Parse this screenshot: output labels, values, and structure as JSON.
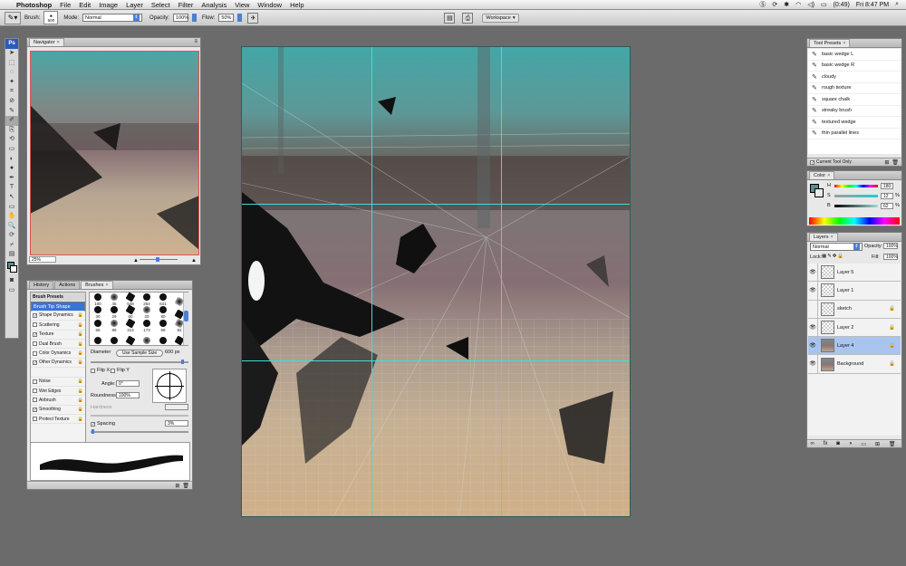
{
  "menubar": {
    "app": "Photoshop",
    "items": [
      "File",
      "Edit",
      "Image",
      "Layer",
      "Select",
      "Filter",
      "Analysis",
      "View",
      "Window",
      "Help"
    ],
    "battery": "(0:49)",
    "clock": "Fri 8:47 PM"
  },
  "options": {
    "brush_label": "Brush:",
    "brush_size": "600",
    "mode_label": "Mode:",
    "mode_value": "Normal",
    "opacity_label": "Opacity:",
    "opacity_value": "100%",
    "flow_label": "Flow:",
    "flow_value": "50%",
    "workspace_label": "Workspace"
  },
  "tools": {
    "logo": "Ps",
    "glyphs": [
      "➤",
      "⬚",
      "◌",
      "✦",
      "⌗",
      "⊘",
      "✎",
      "✐",
      "⎘",
      "⟲",
      "▭",
      "◐",
      "●",
      "✒",
      "T",
      "↖",
      "▭",
      "✋",
      "🔍"
    ]
  },
  "navigator": {
    "tab": "Navigator",
    "zoom": "25%"
  },
  "brushes_panel": {
    "tabs": [
      "History",
      "Actions",
      "Brushes"
    ],
    "rows": [
      {
        "label": "Brush Presets",
        "type": "header"
      },
      {
        "label": "Brush Tip Shape",
        "type": "selected"
      },
      {
        "label": "Shape Dynamics",
        "checked": true
      },
      {
        "label": "Scattering",
        "checked": false
      },
      {
        "label": "Texture",
        "checked": true
      },
      {
        "label": "Dual Brush",
        "checked": false
      },
      {
        "label": "Color Dynamics",
        "checked": false
      },
      {
        "label": "Other Dynamics",
        "checked": true
      },
      {
        "label": "",
        "checked": null
      },
      {
        "label": "Noise",
        "checked": false
      },
      {
        "label": "Wet Edges",
        "checked": false
      },
      {
        "label": "Airbrush",
        "checked": false
      },
      {
        "label": "Smoothing",
        "checked": true
      },
      {
        "label": "Protect Texture",
        "checked": false
      }
    ],
    "tips": [
      "100",
      "45",
      "548",
      "264",
      "641",
      "",
      "30",
      "29",
      "60",
      "20",
      "80",
      "",
      "65",
      "89",
      "314",
      "173",
      "59",
      "82",
      "",
      "",
      "",
      "",
      "",
      ""
    ],
    "diameter_label": "Diameter",
    "use_sample": "Use Sample Size",
    "diameter_value": "600 px",
    "flipx": "Flip X",
    "flipy": "Flip Y",
    "angle_label": "Angle:",
    "angle_value": "0°",
    "roundness_label": "Roundness:",
    "roundness_value": "100%",
    "hardness_label": "Hardness",
    "spacing_label": "Spacing",
    "spacing_value": "3%"
  },
  "tool_presets": {
    "tab": "Tool Presets",
    "items": [
      "basic wedge L",
      "basic wedge R",
      "cloudy",
      "rough texture",
      "square chalk",
      "streaky brush",
      "textured wedge",
      "thin parallel lines"
    ],
    "current_only": "Current Tool Only"
  },
  "color_panel": {
    "tab": "Color",
    "h_label": "H",
    "h_value": "180",
    "s_label": "S",
    "s_value": "12",
    "pct": "%",
    "b_label": "B",
    "b_value": "62",
    "pct2": "%",
    "fg_color": "#5d8c8c"
  },
  "layers_panel": {
    "tab": "Layers",
    "blend": "Normal",
    "opacity_label": "Opacity:",
    "opacity_value": "100%",
    "lock_label": "Lock:",
    "fill_label": "Fill:",
    "fill_value": "100%",
    "layers": [
      {
        "name": "Layer 5",
        "visible": true,
        "locked": false,
        "active": false
      },
      {
        "name": "Layer 1",
        "visible": true,
        "locked": false,
        "active": false
      },
      {
        "name": "sketch",
        "visible": false,
        "locked": true,
        "active": false
      },
      {
        "name": "Layer 2",
        "visible": true,
        "locked": true,
        "active": false
      },
      {
        "name": "Layer 4",
        "visible": true,
        "locked": true,
        "active": true
      },
      {
        "name": "Background",
        "visible": true,
        "locked": true,
        "active": false
      }
    ],
    "footer_glyphs": [
      "∞",
      "fx",
      "◙",
      "◑",
      "▭",
      "⊞",
      "🗑"
    ]
  },
  "colors": {
    "guide": "#48d9d6",
    "accent": "#3a74d4"
  }
}
